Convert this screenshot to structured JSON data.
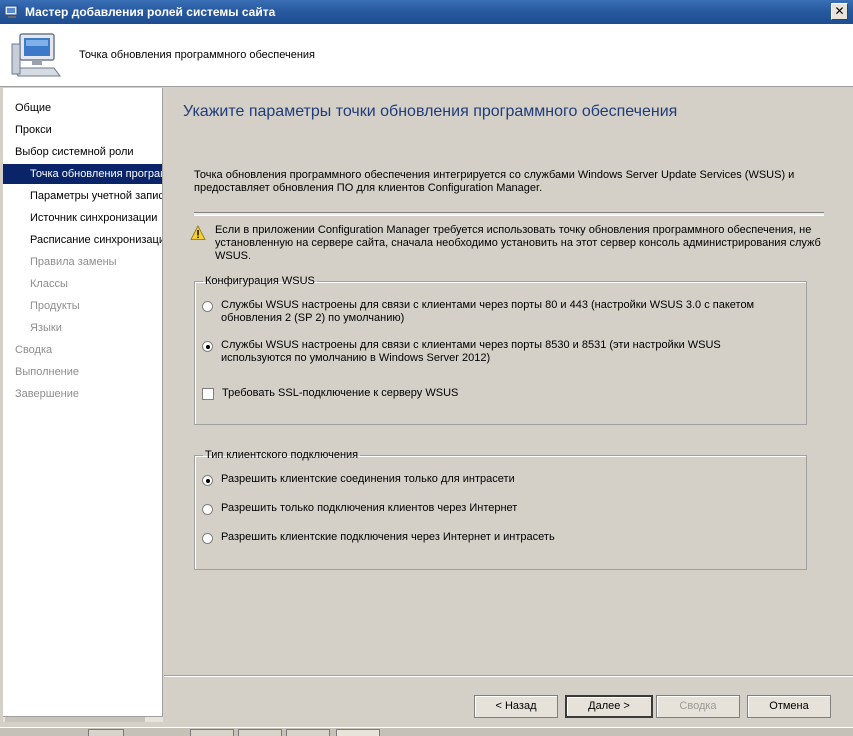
{
  "window": {
    "title": "Мастер добавления ролей системы сайта",
    "close_glyph": "✕"
  },
  "header": {
    "title": "Точка обновления программного обеспечения",
    "icon": "computer-icon"
  },
  "sidebar": {
    "items": [
      {
        "label": "Общие",
        "level": 1,
        "state": "normal"
      },
      {
        "label": "Прокси",
        "level": 1,
        "state": "normal"
      },
      {
        "label": "Выбор системной роли",
        "level": 1,
        "state": "normal"
      },
      {
        "label": "Точка обновления програм",
        "level": 2,
        "state": "selected"
      },
      {
        "label": "Параметры учетной запис",
        "level": 2,
        "state": "normal"
      },
      {
        "label": "Источник синхронизации",
        "level": 2,
        "state": "normal"
      },
      {
        "label": "Расписание синхронизаци",
        "level": 2,
        "state": "normal"
      },
      {
        "label": "Правила замены",
        "level": 2,
        "state": "disabled"
      },
      {
        "label": "Классы",
        "level": 2,
        "state": "disabled"
      },
      {
        "label": "Продукты",
        "level": 2,
        "state": "disabled"
      },
      {
        "label": "Языки",
        "level": 2,
        "state": "disabled"
      },
      {
        "label": "Сводка",
        "level": 1,
        "state": "disabled"
      },
      {
        "label": "Выполнение",
        "level": 1,
        "state": "disabled"
      },
      {
        "label": "Завершение",
        "level": 1,
        "state": "disabled"
      }
    ]
  },
  "main": {
    "heading": "Укажите параметры точки обновления программного обеспечения",
    "intro": "Точка обновления программного обеспечения интегрируется со службами Windows Server Update Services (WSUS) и предоставляет обновления ПО для клиентов Configuration Manager.",
    "warning": "Если в приложении Configuration Manager требуется использовать точку обновления программного обеспечения, не установленную на сервере сайта, сначала необходимо установить на этот сервер консоль администрирования служб WSUS.",
    "warning_icon": "warning-icon",
    "wsus_group": {
      "legend": "Конфигурация WSUS",
      "option1": "Службы WSUS настроены для связи с клиентами через порты 80 и 443 (настройки WSUS 3.0 с пакетом обновления 2 (SP 2) по умолчанию)",
      "option2": "Службы WSUS настроены для связи с клиентами через порты 8530 и 8531 (эти настройки WSUS используются по умолчанию в Windows Server 2012)",
      "selected": 2,
      "ssl_label": "Требовать SSL-подключение к серверу WSUS",
      "ssl_checked": false
    },
    "client_group": {
      "legend": "Тип клиентского подключения",
      "option1": "Разрешить клиентские соединения только для интрасети",
      "option2": "Разрешить только подключения клиентов через Интернет",
      "option3": "Разрешить клиентские подключения через Интернет и интрасеть",
      "selected": 1
    }
  },
  "buttons": {
    "back": "< Назад",
    "next": "Далее >",
    "summary": "Сводка",
    "cancel": "Отмена"
  }
}
